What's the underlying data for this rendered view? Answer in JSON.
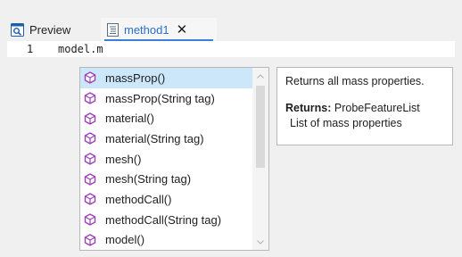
{
  "tabs": [
    {
      "label": "Preview",
      "icon": "preview-icon",
      "active": false
    },
    {
      "label": "method1",
      "icon": "document-icon",
      "active": true,
      "close": "✕"
    }
  ],
  "editor": {
    "line_number": "1",
    "code": "model.m"
  },
  "completion": {
    "items": [
      {
        "label": "massProp()",
        "icon": "method-cube-icon",
        "selected": true
      },
      {
        "label": "massProp(String tag)",
        "icon": "method-cube-icon"
      },
      {
        "label": "material()",
        "icon": "method-cube-icon"
      },
      {
        "label": "material(String tag)",
        "icon": "method-cube-icon"
      },
      {
        "label": "mesh()",
        "icon": "method-cube-icon"
      },
      {
        "label": "mesh(String tag)",
        "icon": "method-cube-icon"
      },
      {
        "label": "methodCall()",
        "icon": "method-cube-icon"
      },
      {
        "label": "methodCall(String tag)",
        "icon": "method-cube-icon"
      },
      {
        "label": "model()",
        "icon": "method-cube-icon"
      }
    ]
  },
  "tooltip": {
    "description": "Returns all mass properties.",
    "returns_label": "Returns:",
    "returns_type": " ProbeFeatureList",
    "returns_description": "List of mass properties"
  },
  "colors": {
    "accent": "#2a6fcf",
    "selection": "#cce6fa",
    "method_icon": "#9b3fb5",
    "error": "#e02020"
  }
}
